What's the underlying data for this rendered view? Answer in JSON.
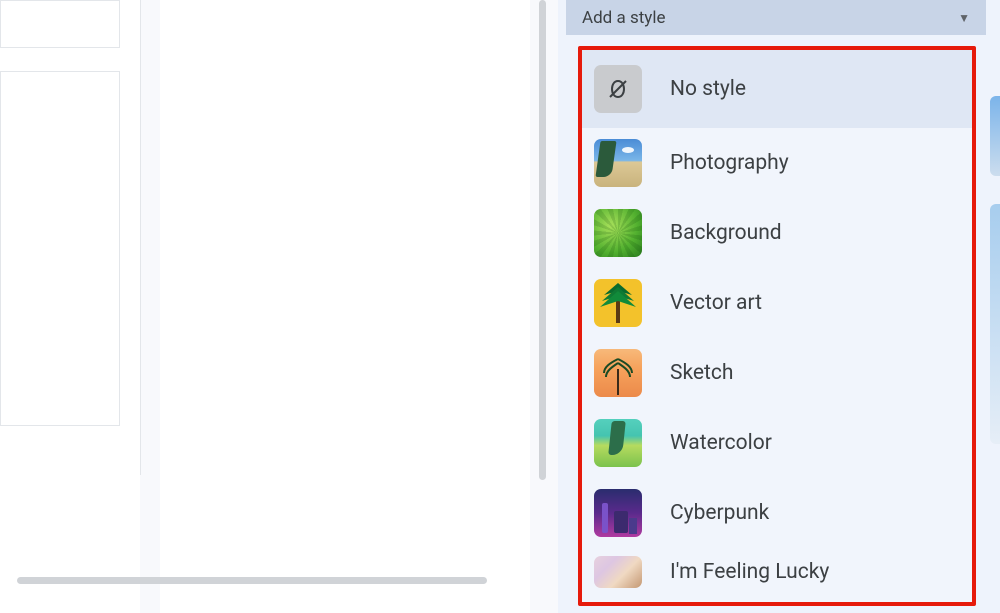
{
  "dropdown": {
    "label": "Add a style",
    "selected_index": 0,
    "options": [
      {
        "label": "No style",
        "icon": "no-style"
      },
      {
        "label": "Photography",
        "icon": "photography"
      },
      {
        "label": "Background",
        "icon": "background"
      },
      {
        "label": "Vector art",
        "icon": "vector-art"
      },
      {
        "label": "Sketch",
        "icon": "sketch"
      },
      {
        "label": "Watercolor",
        "icon": "watercolor"
      },
      {
        "label": "Cyberpunk",
        "icon": "cyberpunk"
      },
      {
        "label": "I'm Feeling Lucky",
        "icon": "lucky"
      }
    ]
  }
}
